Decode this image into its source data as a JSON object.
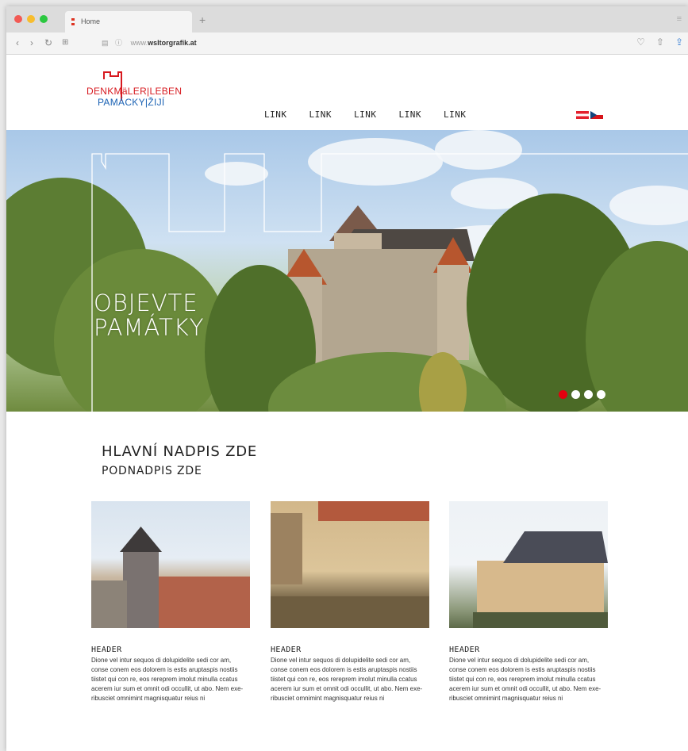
{
  "browser": {
    "tab_title": "Home",
    "new_tab": "+",
    "url_prefix": "www.",
    "url_host": "wsltorgrafik.at"
  },
  "site": {
    "logo_line1": "DENKMäLER|LEBEN",
    "logo_line2": "PAMÁCKY|ŽIJÍ",
    "nav": [
      "LINK",
      "LINK",
      "LINK",
      "LINK",
      "LINK"
    ],
    "flags": [
      "austria-flag",
      "czech-flag"
    ]
  },
  "hero": {
    "title_line1": "OBJEVTE",
    "title_line2": "PAMÁTKY",
    "slides": 4,
    "active_slide": 1
  },
  "main": {
    "title": "HLAVNÍ NADPIS ZDE",
    "subtitle": "PODNADPIS ZDE",
    "cards": [
      {
        "header": "HEADER",
        "text": "Dione vel intur sequos di dolupidelite sedi cor am, conse conem eos dolorem is estis aruptaspis nostiis tiistet qui con re, eos rereprem imolut minulla ccatus acerem iur sum et omnit odi occullit, ut abo. Nem exe-ribusciet omnimint magnisquatur reius ni"
      },
      {
        "header": "HEADER",
        "text": "Dione vel intur sequos di dolupidelite sedi cor am, conse conem eos dolorem is estis aruptaspis nostiis tiistet qui con re, eos rereprem imolut minulla ccatus acerem iur sum et omnit odi occullit, ut abo. Nem exe-ribusciet omnimint magnisquatur reius ni"
      },
      {
        "header": "HEADER",
        "text": "Dione vel intur sequos di dolupidelite sedi cor am, conse conem eos dolorem is estis aruptaspis nostiis tiistet qui con re, eos rereprem imolut minulla ccatus acerem iur sum et omnit odi occullit, ut abo. Nem exe-ribusciet omnimint magnisquatur reius ni"
      }
    ]
  },
  "colors": {
    "brand_red": "#d7191f",
    "brand_blue": "#1c63b4",
    "active_dot": "#e3000f"
  }
}
